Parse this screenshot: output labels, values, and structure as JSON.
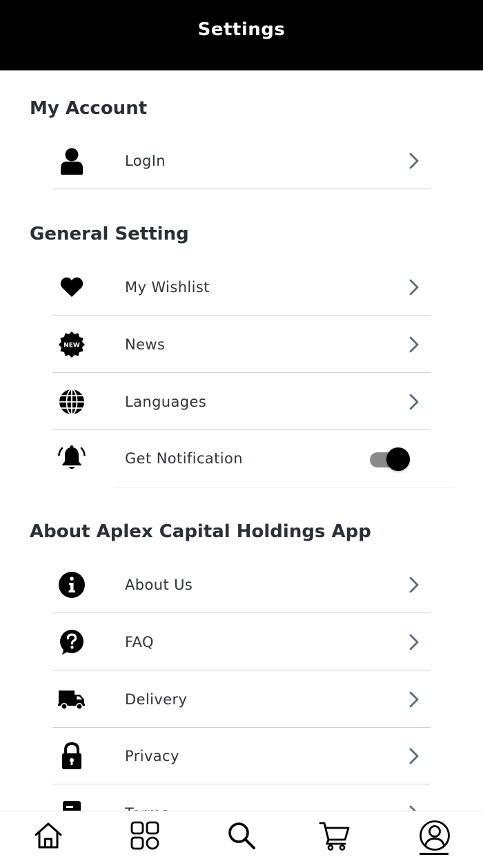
{
  "header": {
    "title": "Settings"
  },
  "sections": {
    "account": {
      "title": "My Account"
    },
    "general": {
      "title": "General Setting"
    },
    "about": {
      "title": "About Aplex Capital Holdings App"
    }
  },
  "items": {
    "login": {
      "label": "LogIn",
      "icon": "user-icon"
    },
    "wishlist": {
      "label": "My Wishlist",
      "icon": "heart-icon"
    },
    "news": {
      "label": "News",
      "icon": "new-badge-icon",
      "badge_text": "NEW"
    },
    "languages": {
      "label": "Languages",
      "icon": "globe-icon"
    },
    "notification": {
      "label": "Get Notification",
      "icon": "bell-icon",
      "enabled": true
    },
    "about_us": {
      "label": "About Us",
      "icon": "info-icon"
    },
    "faq": {
      "label": "FAQ",
      "icon": "question-icon"
    },
    "delivery": {
      "label": "Delivery",
      "icon": "truck-icon"
    },
    "privacy": {
      "label": "Privacy",
      "icon": "lock-icon"
    },
    "terms": {
      "label": "Terms",
      "icon": "document-icon"
    }
  },
  "tabbar": {
    "tabs": [
      {
        "name": "home",
        "icon": "home-icon"
      },
      {
        "name": "categories",
        "icon": "grid-icon"
      },
      {
        "name": "search",
        "icon": "search-icon"
      },
      {
        "name": "cart",
        "icon": "cart-icon"
      },
      {
        "name": "profile",
        "icon": "profile-icon",
        "active": true
      }
    ]
  },
  "colors": {
    "header_bg": "#000000",
    "text": "#2b3038",
    "chevron": "#5b6b78",
    "divider": "#cfd3d7",
    "toggle_track": "#8a8a8a"
  }
}
